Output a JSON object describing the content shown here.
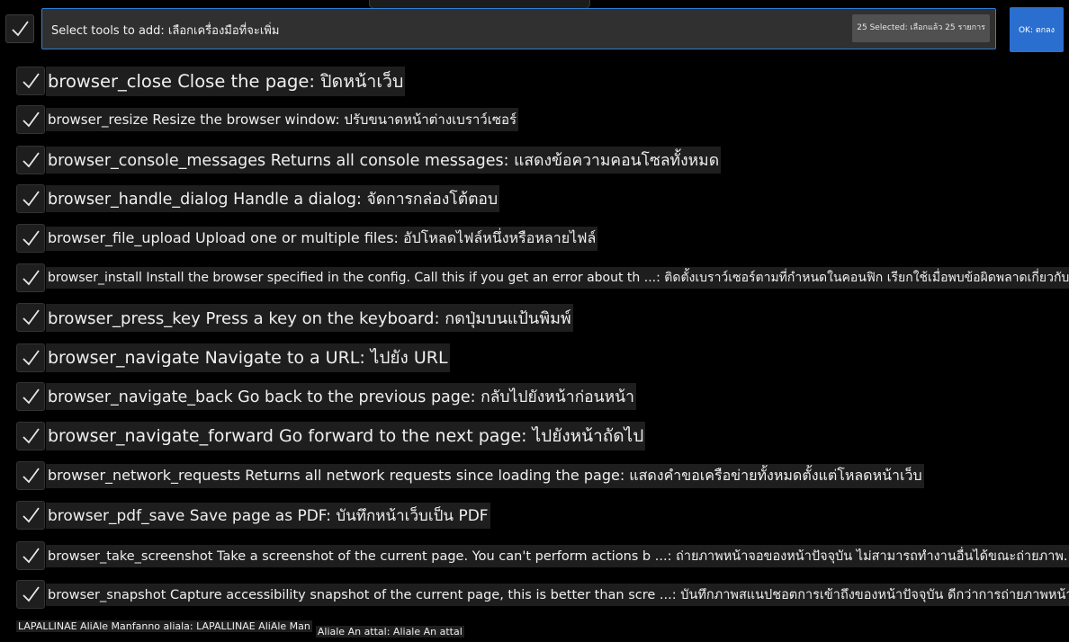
{
  "header": {
    "search_value": "Select tools to add: เลือกเครื่องมือที่จะเพิ่ม",
    "selected_count": "25 Selected: เลือกแล้ว 25 รายการ",
    "ok_label": "OK: ตกลง"
  },
  "tools": [
    {
      "label": "browser_close Close the page: ปิดหน้าเว็บ"
    },
    {
      "label": "browser_resize Resize the browser window: ปรับขนาดหน้าต่างเบราว์เซอร์"
    },
    {
      "label": "browser_console_messages Returns all console messages: แสดงข้อความคอนโซลทั้งหมด"
    },
    {
      "label": "browser_handle_dialog Handle a dialog: จัดการกล่องโต้ตอบ"
    },
    {
      "label": "browser_file_upload Upload one or multiple files: อัปโหลดไฟล์หนึ่งหรือหลายไฟล์"
    },
    {
      "label": "browser_install Install the browser specified in the config. Call this if you get an error about th ...: ติดตั้งเบราว์เซอร์ตามที่กำหนดในคอนฟิก เรียกใช้เมื่อพบข้อผิดพลาดเกี่ยวกับ..."
    },
    {
      "label": "browser_press_key Press a key on the keyboard: กดปุ่มบนแป้นพิมพ์"
    },
    {
      "label": "browser_navigate Navigate to a URL: ไปยัง URL"
    },
    {
      "label": "browser_navigate_back Go back to the previous page: กลับไปยังหน้าก่อนหน้า"
    },
    {
      "label": "browser_navigate_forward Go forward to the next page: ไปยังหน้าถัดไป"
    },
    {
      "label": "browser_network_requests Returns all network requests since loading the page: แสดงคำขอเครือข่ายทั้งหมดตั้งแต่โหลดหน้าเว็บ"
    },
    {
      "label": "browser_pdf_save Save page as PDF: บันทึกหน้าเว็บเป็น PDF"
    },
    {
      "label": "browser_take_screenshot Take a screenshot of the current page. You can't perform actions b ...: ถ่ายภาพหน้าจอของหน้าปัจจุบัน ไม่สามารถทำงานอื่นได้ขณะถ่ายภาพ..."
    },
    {
      "label": "browser_snapshot Capture accessibility snapshot of the current page, this is better than scre ...: บันทึกภาพสแนปชอตการเข้าถึงของหน้าปัจจุบัน ดีกว่าการถ่ายภาพหน้าจอ..."
    },
    {
      "label": "LAPALLINAE AliAle Manfanno aliala: LAPALLINAE AliAle Man"
    }
  ],
  "clipped_overlay": "Aliale An attal: Aliale An attal"
}
